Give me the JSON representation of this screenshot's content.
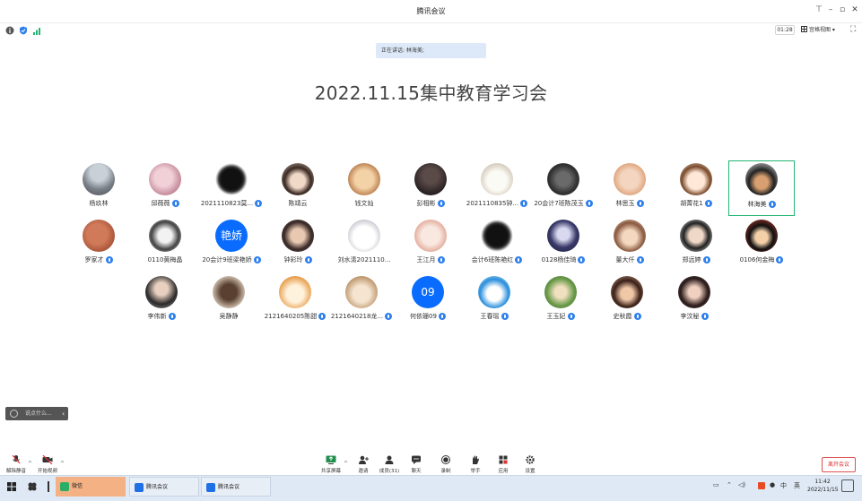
{
  "window": {
    "title": "腾讯会议"
  },
  "topbar": {
    "timer": "01:28",
    "view_label": "宫格视图"
  },
  "speaking_banner": "正在讲话: 林海美;",
  "meeting_title": "2022.11.15集中教育学习会",
  "participants": [
    {
      "name": "杨玖林",
      "mic": false,
      "avatar": "photo-city"
    },
    {
      "name": "邱薇薇",
      "mic": true,
      "avatar": "photo-pink"
    },
    {
      "name": "2021110823莫...",
      "mic": true,
      "avatar": "fuzzball"
    },
    {
      "name": "陈靖云",
      "mic": false,
      "avatar": "photo-girl"
    },
    {
      "name": "钱文灿",
      "mic": false,
      "avatar": "photo-face"
    },
    {
      "name": "彭相彬",
      "mic": true,
      "avatar": "photo-dark"
    },
    {
      "name": "2021110835钟...",
      "mic": true,
      "avatar": "photo-dog"
    },
    {
      "name": "20会计7班陈茂玉",
      "mic": true,
      "avatar": "photo-group"
    },
    {
      "name": "林思玉",
      "mic": true,
      "avatar": "photo-baby"
    },
    {
      "name": "胡菁花1",
      "mic": true,
      "avatar": "photo-cartoon"
    },
    {
      "name": "林海美",
      "mic": true,
      "avatar": "photo-person",
      "active": true
    },
    {
      "name": "罗家才",
      "mic": true,
      "avatar": "photo-rust"
    },
    {
      "name": "0110黄梅晶",
      "mic": false,
      "avatar": "photo-bw"
    },
    {
      "name": "20会计9班梁艳娇",
      "mic": true,
      "avatar": "text",
      "avatar_text": "艳娇"
    },
    {
      "name": "钟彩玲",
      "mic": true,
      "avatar": "photo-girl2"
    },
    {
      "name": "刘水清2021110...",
      "mic": false,
      "avatar": "photo-cat"
    },
    {
      "name": "王江月",
      "mic": true,
      "avatar": "photo-bunny"
    },
    {
      "name": "会计6班陈艳红",
      "mic": true,
      "avatar": "fuzzball"
    },
    {
      "name": "0128杨佳琦",
      "mic": true,
      "avatar": "photo-moon"
    },
    {
      "name": "董大仟",
      "mic": true,
      "avatar": "photo-girl3"
    },
    {
      "name": "郑远婷",
      "mic": true,
      "avatar": "photo-sunglasses"
    },
    {
      "name": "0106何金梅",
      "mic": true,
      "avatar": "photo-mickey"
    },
    {
      "name": "李伟新",
      "mic": true,
      "avatar": "photo-suit"
    },
    {
      "name": "吴静静",
      "mic": false,
      "avatar": "photo-back"
    },
    {
      "name": "2121640205陈甜",
      "mic": true,
      "avatar": "photo-shiba"
    },
    {
      "name": "2121640218龙...",
      "mic": true,
      "avatar": "photo-hamster"
    },
    {
      "name": "何依珊09",
      "mic": true,
      "avatar": "text",
      "avatar_text": "09"
    },
    {
      "name": "王春瑶",
      "mic": true,
      "avatar": "photo-doraemon"
    },
    {
      "name": "王玉妃",
      "mic": true,
      "avatar": "photo-green"
    },
    {
      "name": "史秋霞",
      "mic": true,
      "avatar": "photo-hair"
    },
    {
      "name": "李汶秘",
      "mic": true,
      "avatar": "photo-dark2"
    }
  ],
  "chat_pill": {
    "placeholder": "说点什么..."
  },
  "toolbar": {
    "unmute": "解除静音",
    "start_video": "开始视频",
    "share": "共享屏幕",
    "invite": "邀请",
    "members": "成员(31)",
    "chat": "聊天",
    "record": "录制",
    "raise_hand": "举手",
    "apps": "应用",
    "settings": "设置",
    "leave": "离开会议"
  },
  "taskbar": {
    "apps": [
      "微信",
      "腾讯会议",
      "腾讯会议"
    ],
    "ime": "中",
    "ime2": "英",
    "time": "11:42",
    "date": "2022/11/15"
  },
  "colors": {
    "accent": "#2f80ed",
    "active_border": "#22b573",
    "leave": "#d93030"
  }
}
